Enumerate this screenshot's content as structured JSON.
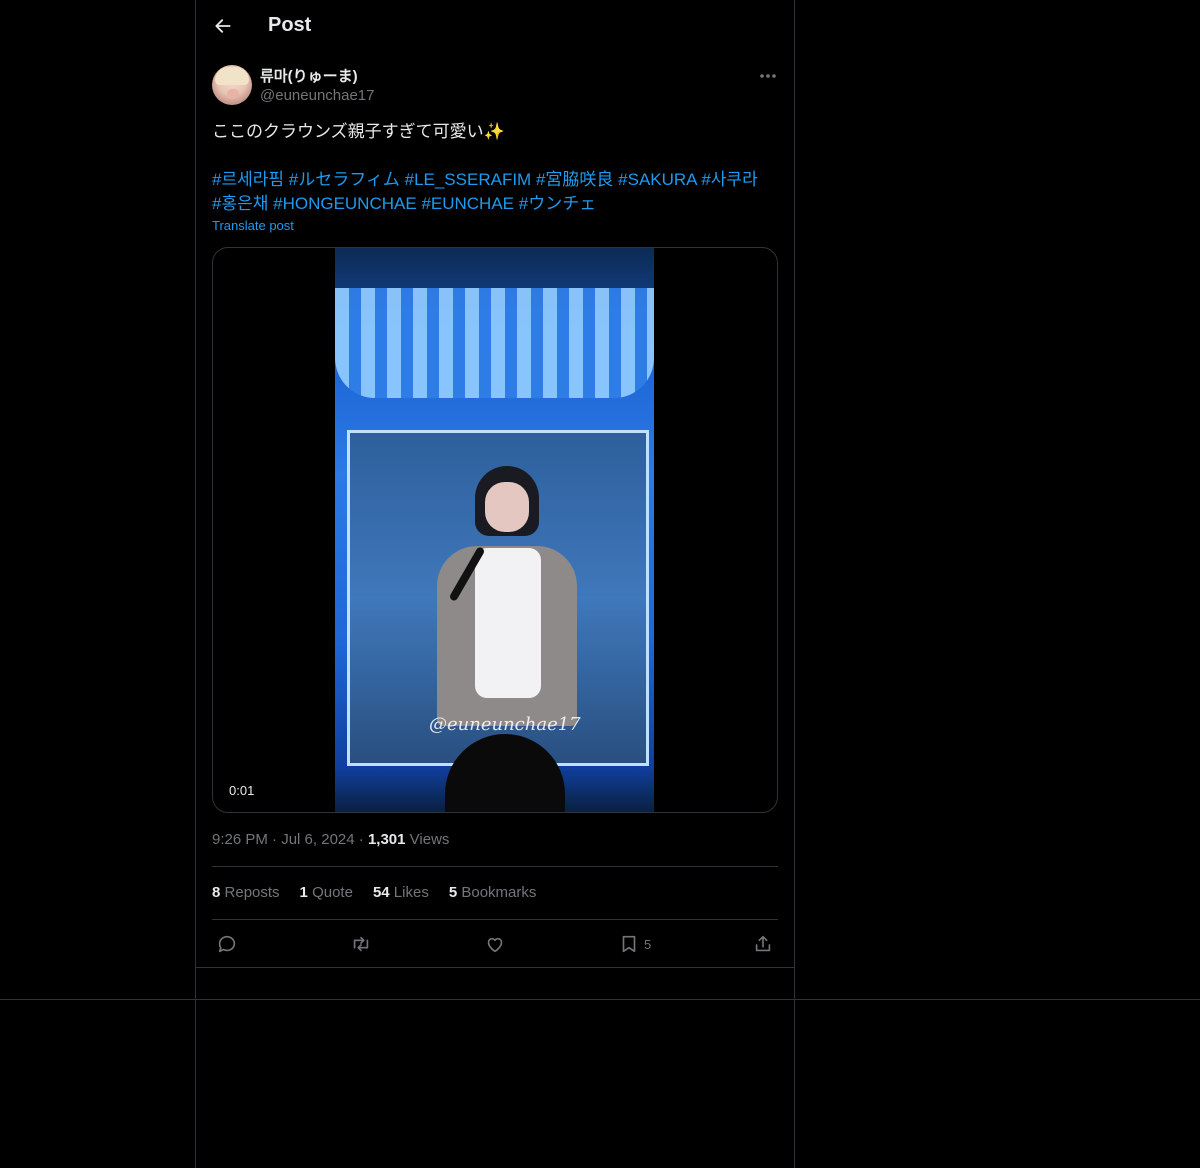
{
  "header": {
    "title": "Post"
  },
  "author": {
    "display_name": "류마(りゅーま)",
    "handle": "@euneunchae17"
  },
  "tweet": {
    "text": "ここのクラウンズ親子すぎて可愛い✨",
    "hashtags": [
      "#르세라핌",
      "#ルセラフィム",
      "#LE_SSERAFIM",
      "#宮脇咲良",
      "#SAKURA",
      "#사쿠라",
      "#홍은채",
      "#HONGEUNCHAE",
      "#EUNCHAE",
      "#ウンチェ"
    ],
    "translate_label": "Translate post"
  },
  "media": {
    "time": "0:01",
    "watermark": "@euneunchae17"
  },
  "meta": {
    "time": "9:26 PM",
    "date": "Jul 6, 2024",
    "views_count": "1,301",
    "views_label": "Views",
    "dot": "·"
  },
  "stats": {
    "reposts": {
      "count": "8",
      "label": "Reposts"
    },
    "quotes": {
      "count": "1",
      "label": "Quote"
    },
    "likes": {
      "count": "54",
      "label": "Likes"
    },
    "bookmarks": {
      "count": "5",
      "label": "Bookmarks"
    }
  },
  "actions": {
    "bookmark_count": "5"
  },
  "icons": [
    "back-arrow-icon",
    "more-icon",
    "reply-icon",
    "repost-icon",
    "like-icon",
    "bookmark-icon",
    "share-icon"
  ],
  "colors": {
    "accent": "#1d9bf0",
    "secondary_text": "#71767b",
    "border": "#2f3336",
    "background": "#000000"
  }
}
